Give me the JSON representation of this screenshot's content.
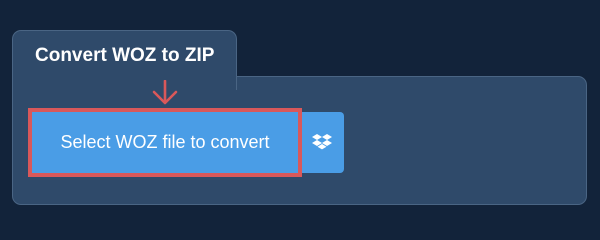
{
  "panel": {
    "tab_title": "Convert WOZ to ZIP"
  },
  "actions": {
    "select_label": "Select WOZ file to convert",
    "dropbox_icon": "dropbox-icon"
  },
  "colors": {
    "page_background": "#12233a",
    "panel_background": "#2f4a6a",
    "panel_border": "#4a6584",
    "button_blue": "#4a9de6",
    "highlight_red": "#d9585a"
  }
}
